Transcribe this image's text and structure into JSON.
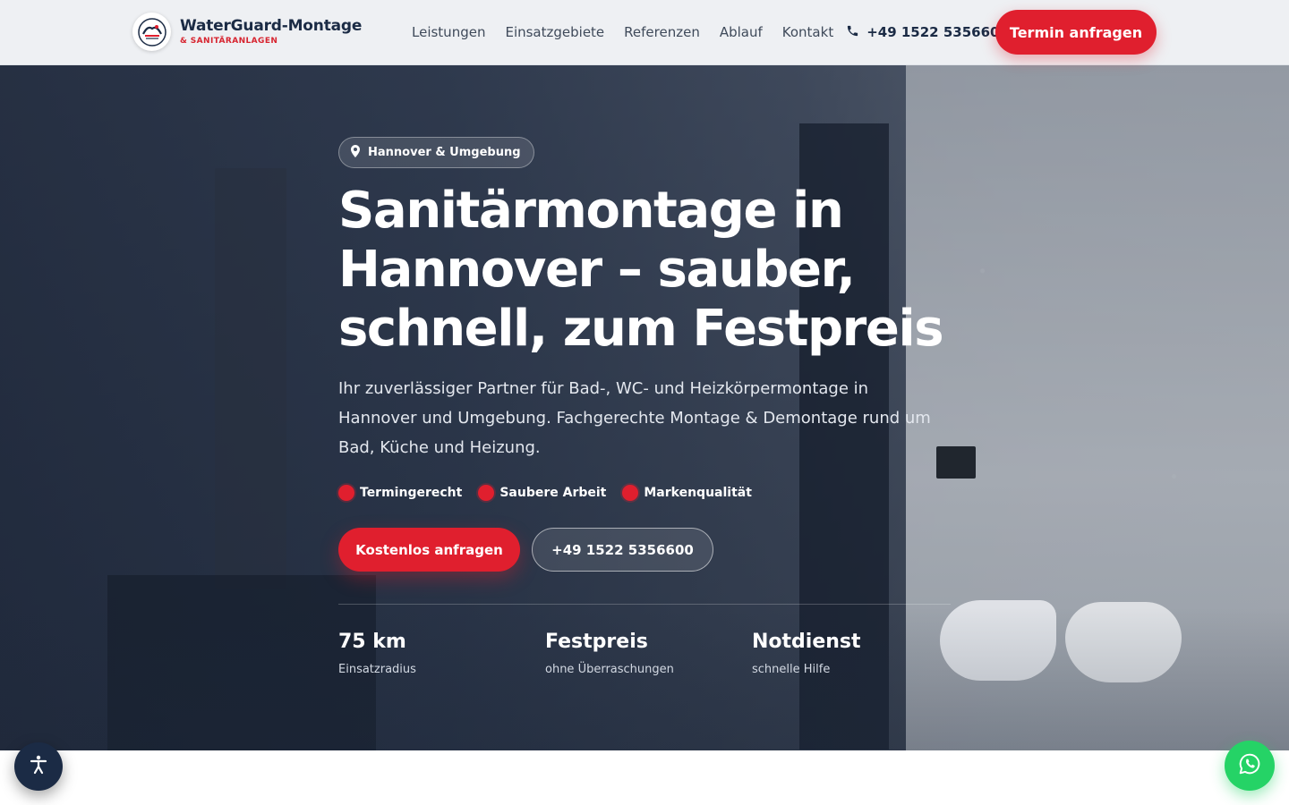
{
  "header": {
    "logo_title": "WaterGuard-Montage",
    "logo_subtitle": "& SANITÄRANLAGEN",
    "logo_icon": "waterguard-logo-icon",
    "nav": [
      {
        "label": "Leistungen"
      },
      {
        "label": "Einsatzgebiete"
      },
      {
        "label": "Referenzen"
      },
      {
        "label": "Ablauf"
      },
      {
        "label": "Kontakt"
      }
    ],
    "phone_icon": "phone-icon",
    "phone": "+49 1522 5356600",
    "cta_label": "Termin anfragen"
  },
  "hero": {
    "location_icon": "map-pin-icon",
    "location": "Hannover & Umgebung",
    "headline": "Sanitärmontage in Hannover – sauber, schnell, zum Festpreis",
    "lead": "Ihr zuverlässiger Partner für Bad-, WC- und Heizkörpermontage in Hannover und Umgebung. Fachgerechte Montage & Demontage rund um Bad, Küche und Heizung.",
    "features": [
      {
        "label": "Termingerecht"
      },
      {
        "label": "Saubere Arbeit"
      },
      {
        "label": "Markenqualität"
      }
    ],
    "primary_button": "Kostenlos anfragen",
    "secondary_button": "+49 1522 5356600",
    "stats": [
      {
        "value": "75 km",
        "label": "Einsatzradius"
      },
      {
        "value": "Festpreis",
        "label": "ohne Überraschungen"
      },
      {
        "value": "Notdienst",
        "label": "schnelle Hilfe"
      }
    ]
  },
  "floating": {
    "accessibility_icon": "accessibility-icon",
    "whatsapp_icon": "whatsapp-icon"
  },
  "colors": {
    "brand_red": "#e01f2e",
    "brand_navy": "#1b2b45",
    "whatsapp_green": "#25d366"
  }
}
